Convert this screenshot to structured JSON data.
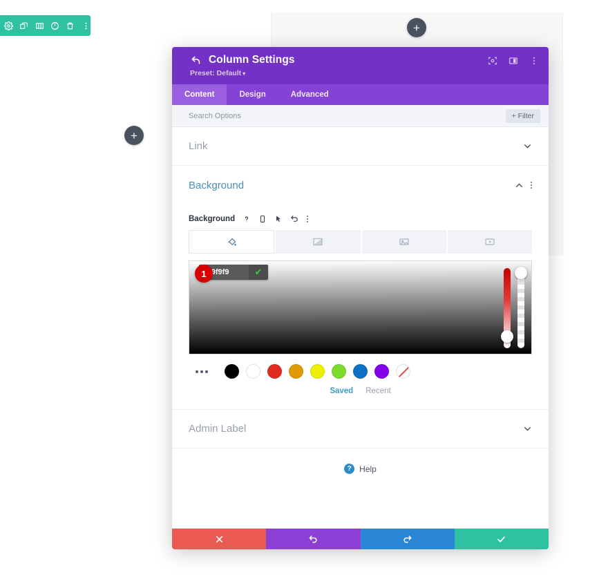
{
  "module_toolbar": {
    "items": [
      {
        "name": "settings-gear-icon",
        "label": "Settings"
      },
      {
        "name": "duplicate-icon",
        "label": "Duplicate"
      },
      {
        "name": "columns-icon",
        "label": "Columns"
      },
      {
        "name": "disable-power-icon",
        "label": "Disable"
      },
      {
        "name": "trash-icon",
        "label": "Delete"
      },
      {
        "name": "more-options-icon",
        "label": "More Options"
      }
    ]
  },
  "canvas": {
    "add_top_label": "+",
    "add_left_label": "+"
  },
  "modal": {
    "title": "Column Settings",
    "preset_label": "Preset: Default",
    "preset_caret": "▾",
    "header_icons": [
      {
        "name": "focus-icon",
        "label": "Focus"
      },
      {
        "name": "split-view-icon",
        "label": "Split View"
      },
      {
        "name": "more-menu-icon",
        "label": "More"
      }
    ],
    "tabs": [
      {
        "label": "Content",
        "active": true
      },
      {
        "label": "Design",
        "active": false
      },
      {
        "label": "Advanced",
        "active": false
      }
    ],
    "search": {
      "placeholder": "Search Options",
      "value": ""
    },
    "filter_button": "+ Filter"
  },
  "sections": {
    "link": {
      "label": "Link",
      "state": "collapsed",
      "chevron": "down"
    },
    "background": {
      "label": "Background",
      "state": "expanded",
      "chevron": "up",
      "field_label": "Background",
      "field_icons": [
        {
          "name": "help-question-icon",
          "glyph": "?"
        },
        {
          "name": "responsive-mobile-icon",
          "glyph": "mobile"
        },
        {
          "name": "hover-cursor-icon",
          "glyph": "cursor"
        },
        {
          "name": "reset-undo-icon",
          "glyph": "undo"
        },
        {
          "name": "field-more-menu-icon",
          "glyph": "dots"
        }
      ],
      "type_tabs": [
        {
          "name": "background-color-tab",
          "icon": "paint-bucket-icon",
          "active": true
        },
        {
          "name": "background-gradient-tab",
          "icon": "gradient-icon",
          "active": false
        },
        {
          "name": "background-image-tab",
          "icon": "image-icon",
          "active": false
        },
        {
          "name": "background-video-tab",
          "icon": "video-icon",
          "active": false
        }
      ],
      "color_picker": {
        "hex_value": "#f9f9f9",
        "confirm_glyph": "✔",
        "step_badge": "1",
        "hue_handle_position_pct": 88,
        "alpha_handle_position_pct": 0,
        "swatches": [
          {
            "name": "swatch-black",
            "color": "#000000"
          },
          {
            "name": "swatch-white",
            "color": "#ffffff"
          },
          {
            "name": "swatch-red",
            "color": "#e02b20"
          },
          {
            "name": "swatch-orange",
            "color": "#e09900"
          },
          {
            "name": "swatch-yellow",
            "color": "#edf000"
          },
          {
            "name": "swatch-green",
            "color": "#7cdb2c"
          },
          {
            "name": "swatch-blue",
            "color": "#0c71c3"
          },
          {
            "name": "swatch-purple",
            "color": "#8300e9"
          },
          {
            "name": "swatch-transparent",
            "color": "transparent"
          }
        ],
        "saved_tab": "Saved",
        "recent_tab": "Recent"
      }
    },
    "admin_label": {
      "label": "Admin Label",
      "state": "collapsed",
      "chevron": "down"
    }
  },
  "help": {
    "label": "Help",
    "glyph": "?"
  },
  "footer": {
    "buttons": [
      {
        "name": "cancel-button",
        "icon": "close-x-icon",
        "color": "#eb5a52"
      },
      {
        "name": "undo-button",
        "icon": "undo-arrow-icon",
        "color": "#8d3fd6"
      },
      {
        "name": "redo-button",
        "icon": "redo-arrow-icon",
        "color": "#2a87d5"
      },
      {
        "name": "save-button",
        "icon": "checkmark-icon",
        "color": "#2ec2a3"
      }
    ]
  },
  "colors": {
    "header_purple": "#7331c6",
    "tabbar_purple": "#8443d4",
    "active_tab_purple": "#9a5fe0",
    "toolbar_teal": "#2ec2a3",
    "badge_red": "#d60000",
    "section_heading_blue": "#4a8eb8"
  }
}
